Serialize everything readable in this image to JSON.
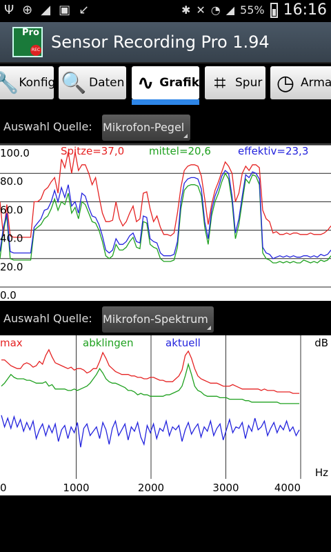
{
  "status": {
    "battery": "55%",
    "time": "16:16"
  },
  "app": {
    "title": "Sensor Recording Pro 1.94",
    "icon_text": "Pro",
    "icon_badge": "REC"
  },
  "tabs": [
    {
      "label": "Konfig",
      "icon": "wrench-icon"
    },
    {
      "label": "Daten",
      "icon": "magnifier-icon"
    },
    {
      "label": "Grafik",
      "icon": "sine-wave-icon",
      "active": true
    },
    {
      "label": "Spur",
      "icon": "track-icon"
    },
    {
      "label": "Arma",
      "icon": "gauge-icon"
    }
  ],
  "source1": {
    "label": "Auswahl Quelle:",
    "value": "Mikrofon-Pegel"
  },
  "source2": {
    "label": "Auswahl Quelle:",
    "value": "Mikrofon-Spektrum"
  },
  "chart_data": [
    {
      "type": "line",
      "ylim": [
        0,
        100
      ],
      "yticks": [
        "100.0",
        "80.0",
        "60.0",
        "40.0",
        "20.0",
        "0.0"
      ],
      "legend": [
        "Spitze=37,0",
        "mittel=20,6",
        "effektiv=23,3"
      ],
      "series": [
        {
          "name": "Spitze",
          "color": "#e52222",
          "values": [
            60,
            36,
            58,
            36,
            35,
            35,
            35,
            35,
            35,
            35,
            60,
            60,
            62,
            68,
            70,
            74,
            77,
            66,
            90,
            84,
            95,
            80,
            95,
            82,
            86,
            86,
            80,
            72,
            77,
            64,
            52,
            46,
            46,
            47,
            60,
            48,
            43,
            46,
            52,
            57,
            46,
            48,
            66,
            67,
            55,
            46,
            50,
            42,
            37,
            37,
            36,
            38,
            52,
            70,
            82,
            85,
            86,
            86,
            85,
            78,
            62,
            44,
            58,
            68,
            74,
            81,
            88,
            85,
            80,
            60,
            66,
            80,
            85,
            82,
            86,
            86,
            84,
            54,
            48,
            46,
            38,
            39,
            37,
            37,
            38,
            37,
            38,
            38,
            37,
            37,
            37,
            38,
            37,
            37,
            37,
            38,
            40,
            43
          ]
        },
        {
          "name": "mittel",
          "color": "#1ea01e",
          "values": [
            20,
            40,
            50,
            20,
            19,
            19,
            19,
            19,
            19,
            19,
            40,
            42,
            44,
            48,
            50,
            55,
            62,
            54,
            60,
            58,
            66,
            52,
            56,
            48,
            60,
            58,
            52,
            46,
            45,
            40,
            32,
            22,
            20,
            22,
            30,
            26,
            26,
            28,
            32,
            35,
            28,
            27,
            46,
            45,
            30,
            28,
            27,
            20,
            18,
            18,
            18,
            19,
            28,
            55,
            68,
            71,
            72,
            72,
            71,
            64,
            42,
            30,
            50,
            60,
            66,
            74,
            80,
            76,
            60,
            34,
            44,
            60,
            76,
            73,
            79,
            78,
            72,
            24,
            20,
            19,
            17,
            17,
            18,
            17,
            18,
            17,
            18,
            17,
            17,
            19,
            18,
            17,
            18,
            17,
            19,
            18,
            19,
            22
          ]
        },
        {
          "name": "effektiv",
          "color": "#2222dd",
          "values": [
            25,
            42,
            52,
            25,
            24,
            24,
            24,
            24,
            24,
            24,
            42,
            45,
            48,
            54,
            55,
            60,
            68,
            60,
            70,
            63,
            72,
            57,
            60,
            52,
            66,
            64,
            56,
            50,
            49,
            44,
            36,
            26,
            24,
            26,
            34,
            30,
            30,
            32,
            36,
            38,
            32,
            31,
            50,
            49,
            34,
            32,
            31,
            24,
            22,
            22,
            22,
            23,
            32,
            60,
            73,
            76,
            77,
            77,
            76,
            69,
            46,
            34,
            54,
            64,
            70,
            78,
            82,
            80,
            64,
            38,
            48,
            64,
            79,
            77,
            81,
            80,
            76,
            28,
            24,
            23,
            20,
            21,
            22,
            21,
            22,
            21,
            22,
            21,
            21,
            22,
            22,
            21,
            22,
            21,
            23,
            22,
            23,
            26
          ]
        }
      ]
    },
    {
      "type": "line",
      "xlim": [
        0,
        4000
      ],
      "xticks": [
        "0",
        "1000",
        "2000",
        "3000",
        "4000"
      ],
      "ylabel": "dB",
      "xlabel": "Hz",
      "legend": [
        "max",
        "abklingen",
        "aktuell"
      ],
      "series": [
        {
          "name": "max",
          "color": "#e52222",
          "values": [
            46,
            46,
            44,
            42,
            41,
            40,
            40,
            43,
            44,
            43,
            41,
            42,
            45,
            43,
            49,
            53,
            48,
            44,
            43,
            42,
            41,
            40,
            41,
            39,
            40,
            40,
            39,
            37,
            38,
            40,
            40,
            45,
            51,
            47,
            42,
            40,
            38,
            37,
            36,
            36,
            36,
            35,
            35,
            34,
            34,
            33,
            33,
            34,
            34,
            33,
            32,
            32,
            31,
            31,
            31,
            33,
            35,
            39,
            49,
            52,
            47,
            40,
            35,
            33,
            32,
            31,
            30,
            30,
            30,
            29,
            28,
            28,
            28,
            29,
            28,
            27,
            26,
            26,
            26,
            26,
            26,
            26,
            25,
            26,
            25,
            25,
            25,
            24,
            24,
            24,
            24,
            24,
            23,
            23,
            23
          ]
        },
        {
          "name": "abklingen",
          "color": "#1ea01e",
          "values": [
            28,
            30,
            33,
            36,
            34,
            33,
            33,
            33,
            32,
            32,
            31,
            30,
            30,
            30,
            31,
            28,
            29,
            26,
            26,
            26,
            26,
            25,
            25,
            26,
            25,
            26,
            27,
            28,
            30,
            33,
            36,
            40,
            37,
            33,
            31,
            30,
            30,
            29,
            28,
            27,
            25,
            25,
            24,
            22,
            23,
            22,
            22,
            21,
            21,
            21,
            21,
            21,
            22,
            22,
            23,
            24,
            25,
            28,
            35,
            43,
            36,
            28,
            25,
            24,
            22,
            21,
            21,
            21,
            21,
            20,
            20,
            20,
            19,
            19,
            19,
            19,
            19,
            18,
            18,
            17,
            17,
            17,
            17,
            17,
            17,
            17,
            17,
            17,
            16,
            16,
            16,
            16,
            16,
            16,
            16
          ]
        },
        {
          "name": "aktuell",
          "color": "#2222dd",
          "values": [
            8,
            0,
            6,
            -1,
            7,
            0,
            5,
            -3,
            3,
            -2,
            4,
            -8,
            -2,
            2,
            -6,
            1,
            -4,
            2,
            -10,
            -2,
            1,
            -8,
            0,
            -4,
            3,
            -14,
            -1,
            2,
            -6,
            -3,
            0,
            -8,
            3,
            -2,
            -12,
            -1,
            4,
            -6,
            -2,
            2,
            -9,
            0,
            -3,
            3,
            -7,
            -12,
            1,
            -4,
            2,
            -8,
            -1,
            -3,
            4,
            -6,
            0,
            -2,
            1,
            -10,
            -2,
            3,
            -5,
            -1,
            2,
            -7,
            0,
            -3,
            4,
            -6,
            -1,
            2,
            -9,
            -2,
            5,
            -4,
            0,
            -1,
            3,
            -8,
            1,
            -3,
            6,
            -2,
            0,
            4,
            -6,
            -1,
            3,
            -4,
            1,
            -2,
            4,
            -3,
            0,
            -6,
            -2
          ]
        }
      ]
    }
  ]
}
